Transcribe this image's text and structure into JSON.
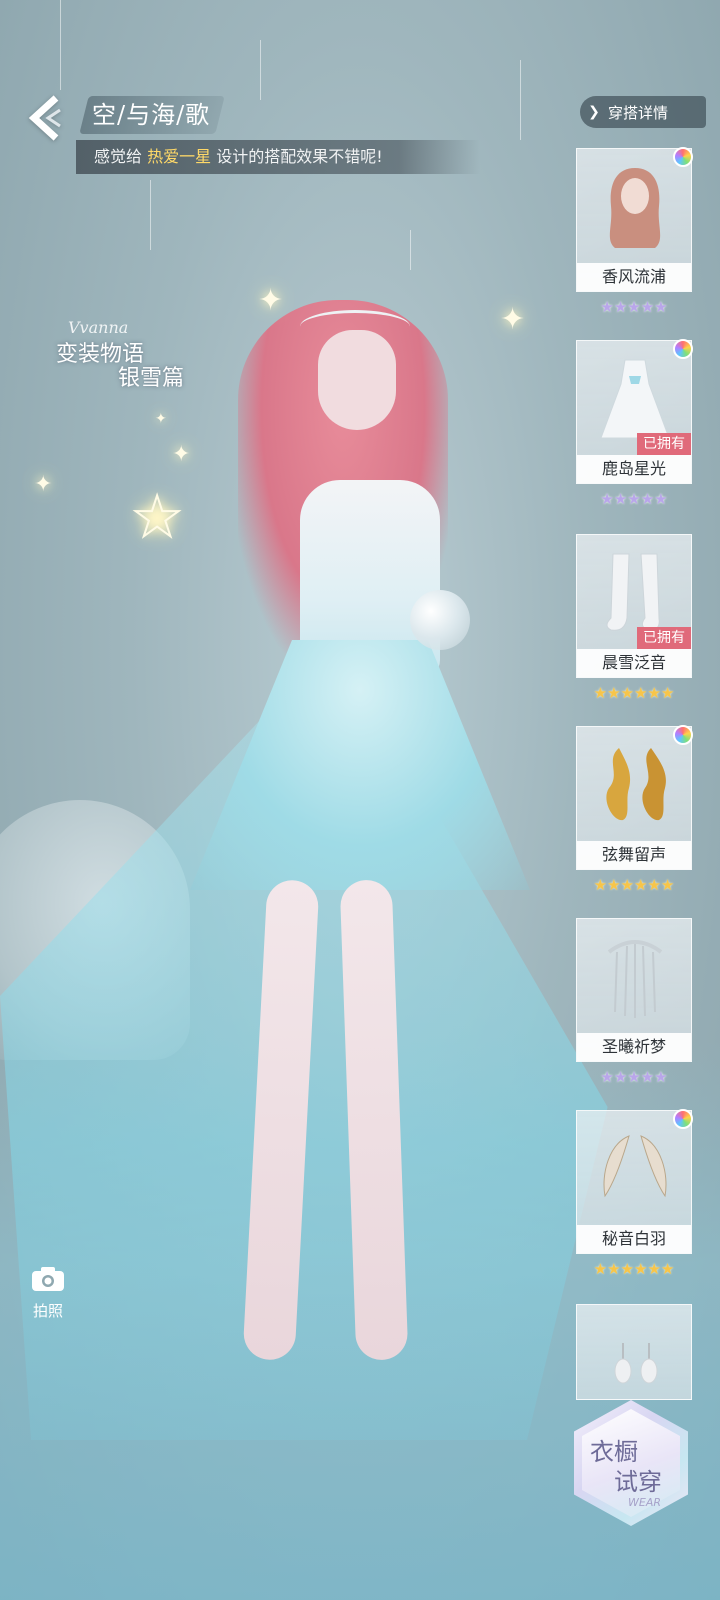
{
  "header": {
    "title": "空/与海/歌",
    "subtitle_prefix": "感觉给 ",
    "subtitle_highlight": "热爱一星",
    "subtitle_suffix": " 设计的搭配效果不错呢!",
    "outfit_detail_label": "穿搭详情"
  },
  "logo": {
    "script_text": "Vvanna",
    "line1": "变装物语",
    "line2": "银雪篇"
  },
  "items": [
    {
      "name": "香风流浦",
      "owned_label": "",
      "rating": "★★★★★",
      "rating_tier": "purple",
      "has_color_icon": true,
      "icon": "hair-icon"
    },
    {
      "name": "鹿岛星光",
      "owned_label": "已拥有",
      "rating": "★★★★★",
      "rating_tier": "purple",
      "has_color_icon": true,
      "icon": "dress-icon"
    },
    {
      "name": "晨雪泛音",
      "owned_label": "已拥有",
      "rating": "★★★★★★",
      "rating_tier": "gold",
      "has_color_icon": false,
      "icon": "stockings-icon"
    },
    {
      "name": "弦舞留声",
      "owned_label": "",
      "rating": "★★★★★★",
      "rating_tier": "gold",
      "has_color_icon": true,
      "icon": "earrings-gold-icon"
    },
    {
      "name": "圣曦祈梦",
      "owned_label": "",
      "rating": "★★★★★",
      "rating_tier": "purple",
      "has_color_icon": false,
      "icon": "headpiece-icon"
    },
    {
      "name": "秘音白羽",
      "owned_label": "",
      "rating": "★★★★★★",
      "rating_tier": "gold",
      "has_color_icon": true,
      "icon": "wings-icon"
    },
    {
      "name": "",
      "owned_label": "",
      "rating": "",
      "rating_tier": "purple",
      "has_color_icon": false,
      "icon": "pearl-earrings-icon"
    }
  ],
  "camera": {
    "label": "拍照"
  },
  "wardrobe": {
    "line1": "衣橱",
    "line2": "试穿",
    "small": "WEAR"
  },
  "colors": {
    "highlight": "#ffd968",
    "owned_badge": "#e06a7a",
    "rating_gold": "#f7c54a",
    "rating_purple": "#b9a6ea"
  }
}
